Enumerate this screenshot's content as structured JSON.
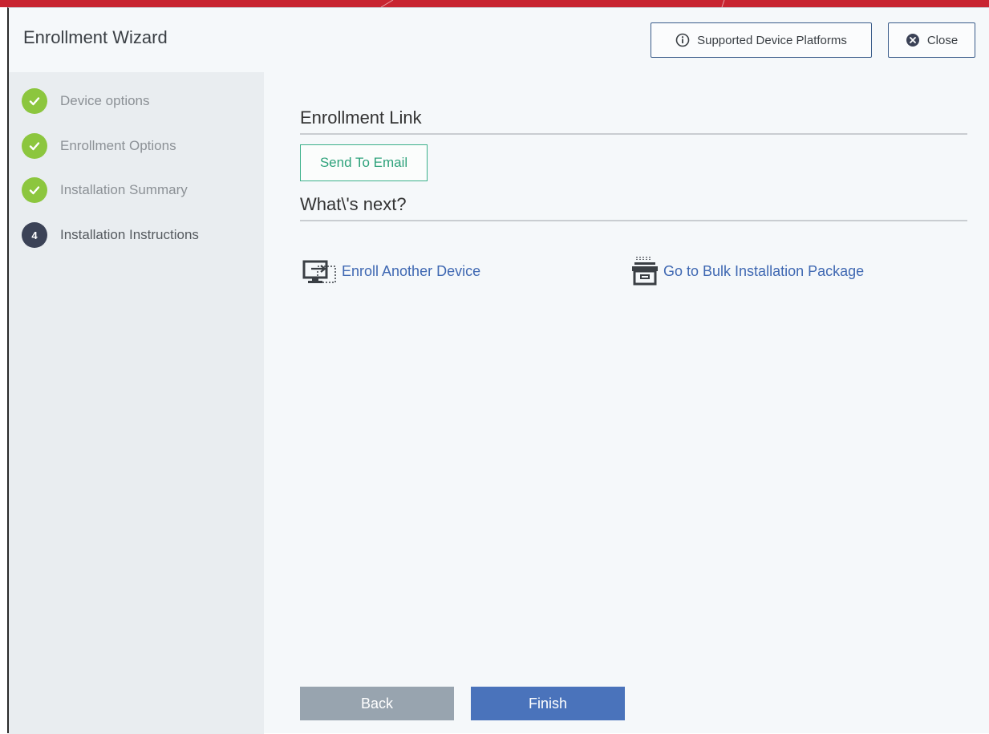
{
  "window": {
    "title": "Enrollment Wizard",
    "accent_color": "#c82430"
  },
  "header": {
    "supported_label": "Supported Device Platforms",
    "close_label": "Close"
  },
  "steps": [
    {
      "label": "Device options",
      "state": "done"
    },
    {
      "label": "Enrollment Options",
      "state": "done"
    },
    {
      "label": "Installation Summary",
      "state": "done"
    },
    {
      "label": "Installation Instructions",
      "state": "current",
      "number": "4"
    }
  ],
  "main": {
    "enrollment_link_title": "Enrollment Link",
    "send_email_label": "Send To Email",
    "whats_next_title": "What\\'s next?",
    "enroll_another_label": "Enroll Another Device",
    "bulk_package_label": "Go to Bulk Installation Package"
  },
  "footer": {
    "back_label": "Back",
    "finish_label": "Finish"
  },
  "icons": {
    "info": "info-circle-icon",
    "close": "close-circle-icon",
    "check": "check-icon",
    "enroll": "monitor-enroll-icon",
    "bulk": "package-icon"
  }
}
